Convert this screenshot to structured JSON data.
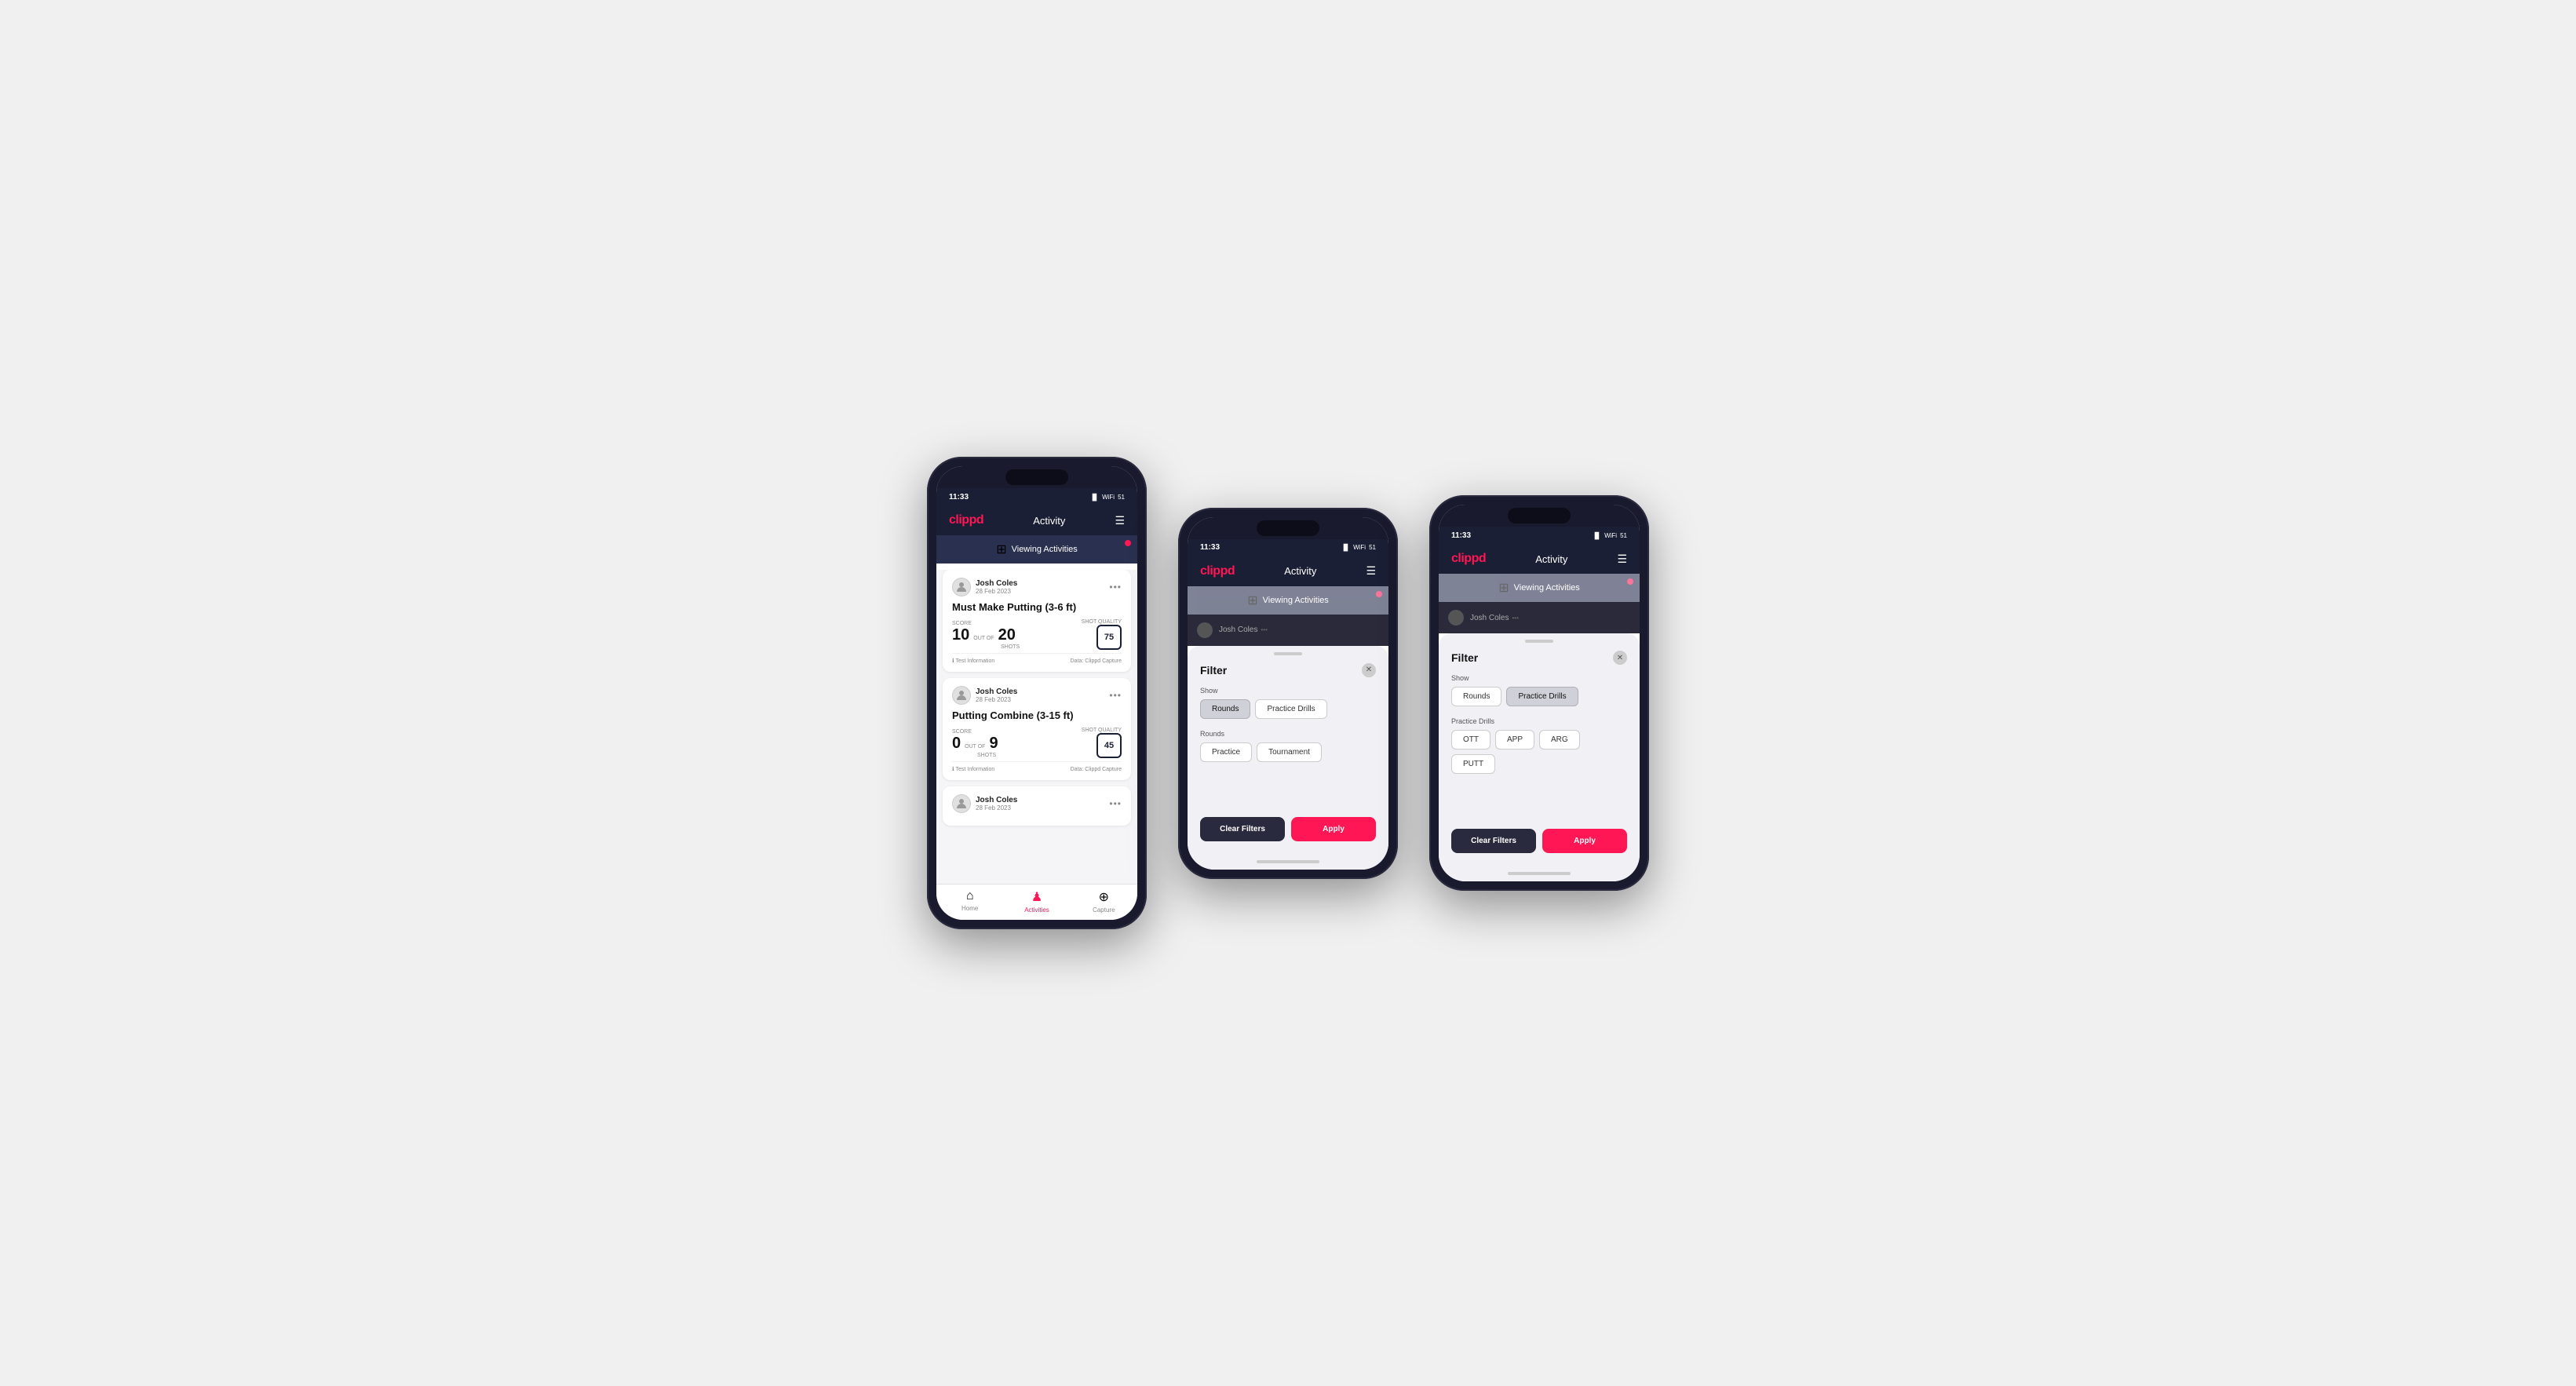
{
  "screens": [
    {
      "id": "screen1",
      "status_time": "11:33",
      "header": {
        "logo": "clippd",
        "title": "Activity",
        "menu_icon": "☰"
      },
      "banner": {
        "text": "Viewing Activities",
        "icon": "⊞"
      },
      "cards": [
        {
          "user_name": "Josh Coles",
          "user_date": "28 Feb 2023",
          "title": "Must Make Putting (3-6 ft)",
          "score_label": "Score",
          "score_value": "10",
          "out_of_text": "OUT OF",
          "shots_label": "Shots",
          "shots_value": "20",
          "shot_quality_label": "Shot Quality",
          "shot_quality_value": "75",
          "footer_left": "ℹ Test Information",
          "footer_right": "Data: Clippd Capture"
        },
        {
          "user_name": "Josh Coles",
          "user_date": "28 Feb 2023",
          "title": "Putting Combine (3-15 ft)",
          "score_label": "Score",
          "score_value": "0",
          "out_of_text": "OUT OF",
          "shots_label": "Shots",
          "shots_value": "9",
          "shot_quality_label": "Shot Quality",
          "shot_quality_value": "45",
          "footer_left": "ℹ Test Information",
          "footer_right": "Data: Clippd Capture"
        },
        {
          "user_name": "Josh Coles",
          "user_date": "28 Feb 2023",
          "title": "",
          "partial": true
        }
      ],
      "nav": {
        "items": [
          {
            "icon": "⌂",
            "label": "Home",
            "active": false
          },
          {
            "icon": "♟",
            "label": "Activities",
            "active": true
          },
          {
            "icon": "+",
            "label": "Capture",
            "active": false
          }
        ]
      }
    },
    {
      "id": "screen2",
      "status_time": "11:33",
      "header": {
        "logo": "clippd",
        "title": "Activity",
        "menu_icon": "☰"
      },
      "banner": {
        "text": "Viewing Activities",
        "icon": "⊞"
      },
      "filter": {
        "title": "Filter",
        "show_label": "Show",
        "show_buttons": [
          {
            "label": "Rounds",
            "active": true
          },
          {
            "label": "Practice Drills",
            "active": false
          }
        ],
        "rounds_label": "Rounds",
        "rounds_buttons": [
          {
            "label": "Practice",
            "active": false
          },
          {
            "label": "Tournament",
            "active": false
          }
        ],
        "clear_label": "Clear Filters",
        "apply_label": "Apply"
      }
    },
    {
      "id": "screen3",
      "status_time": "11:33",
      "header": {
        "logo": "clippd",
        "title": "Activity",
        "menu_icon": "☰"
      },
      "banner": {
        "text": "Viewing Activities",
        "icon": "⊞"
      },
      "filter": {
        "title": "Filter",
        "show_label": "Show",
        "show_buttons": [
          {
            "label": "Rounds",
            "active": false
          },
          {
            "label": "Practice Drills",
            "active": true
          }
        ],
        "practice_drills_label": "Practice Drills",
        "practice_drills_buttons": [
          {
            "label": "OTT",
            "active": false
          },
          {
            "label": "APP",
            "active": false
          },
          {
            "label": "ARG",
            "active": false
          },
          {
            "label": "PUTT",
            "active": false
          }
        ],
        "clear_label": "Clear Filters",
        "apply_label": "Apply"
      }
    }
  ]
}
